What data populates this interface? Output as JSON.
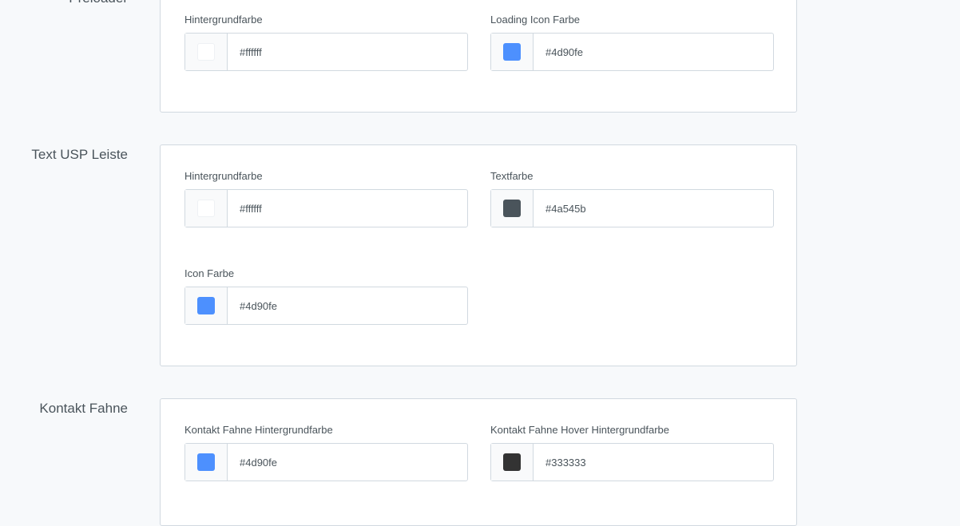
{
  "sections": [
    {
      "title": "Preloader",
      "fields": [
        {
          "label": "Hintergrundfarbe",
          "value": "#ffffff",
          "color": "#ffffff"
        },
        {
          "label": "Loading Icon Farbe",
          "value": "#4d90fe",
          "color": "#4d90fe"
        }
      ]
    },
    {
      "title": "Text USP Leiste",
      "fields": [
        {
          "label": "Hintergrundfarbe",
          "value": "#ffffff",
          "color": "#ffffff"
        },
        {
          "label": "Textfarbe",
          "value": "#4a545b",
          "color": "#4a545b"
        },
        {
          "label": "Icon Farbe",
          "value": "#4d90fe",
          "color": "#4d90fe"
        }
      ]
    },
    {
      "title": "Kontakt Fahne",
      "fields": [
        {
          "label": "Kontakt Fahne Hintergrundfarbe",
          "value": "#4d90fe",
          "color": "#4d90fe"
        },
        {
          "label": "Kontakt Fahne Hover Hintergrundfarbe",
          "value": "#333333",
          "color": "#333333"
        }
      ]
    }
  ]
}
